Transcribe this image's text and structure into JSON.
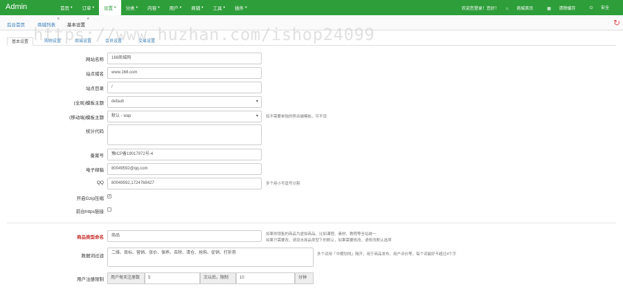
{
  "brand": "Admin",
  "menu": [
    {
      "label": "首页",
      "active": false
    },
    {
      "label": "订单",
      "active": false
    },
    {
      "label": "设置",
      "active": true
    },
    {
      "label": "分类",
      "active": false
    },
    {
      "label": "内容",
      "active": false
    },
    {
      "label": "用户",
      "active": false
    },
    {
      "label": "商铺",
      "active": false
    },
    {
      "label": "工具",
      "active": false
    },
    {
      "label": "插件",
      "active": false
    }
  ],
  "top_right": {
    "greeting": "欢迎您登录！您好！",
    "home": "商城首页",
    "clear_cache": "清除缓存",
    "logout": "安全"
  },
  "page_tabs": [
    "后台首页",
    "商城列表",
    "基本设置"
  ],
  "watermark": "https://www.huzhan.com/ishop24099",
  "sub_tabs": [
    "基本设置",
    "购物设置",
    "商城设置",
    "会员设置",
    "交易设置"
  ],
  "form": {
    "site_name": {
      "label": "网站名称",
      "value": "168商城网"
    },
    "domain": {
      "label": "站点域名",
      "value": "www.168.com"
    },
    "root_dir": {
      "label": "站点目录",
      "value": "/"
    },
    "pc_template": {
      "label": "(全局)模板主题",
      "value": "default"
    },
    "mobile_template": {
      "label": "(移动端)模板主题",
      "value": "默认 - wap",
      "hint": "如不需要单独的移动端模板，可不设"
    },
    "stat_code": {
      "label": "统计代码",
      "value": ""
    },
    "icp": {
      "label": "备案号",
      "value": "豫ICP备19017972号-4"
    },
    "email": {
      "label": "电子邮箱",
      "value": "80049592@qq.com"
    },
    "qq": {
      "label": "QQ",
      "value": "80049592,1724768427",
      "hint": "多个用小写逗号分割"
    },
    "gzip": {
      "label": "开启Gzip压缩",
      "checked": true
    },
    "https": {
      "label": "前台https链接",
      "checked": false
    },
    "goods_type": {
      "label": "商品类型命名",
      "value": "商品",
      "hint1": "如果你销售的商品为虚拟商品、比如课程、素材、教程等全站统一",
      "hint2": "如果只需要改，请双击商品类型下的默认，如果需要修改，请修改默认选项"
    },
    "filter": {
      "label": "数据词过滤",
      "value": "二维、目标、营销、涨价、保养、去除、清仓、抢购、促销、打折券",
      "hint": "多个词用「中横划线」隔开，用于商品发布、用户评价等，每个词最好不超过4个字"
    },
    "register_limit": {
      "label": "用户注册限制",
      "prefix": "用户每天注册数",
      "count": "5",
      "middle": "次以后，限制",
      "minutes": "10",
      "suffix": "分钟"
    }
  }
}
